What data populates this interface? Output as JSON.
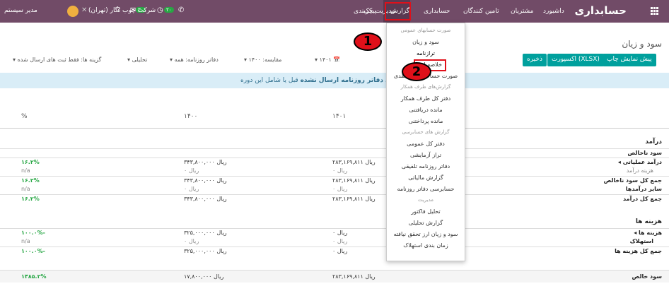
{
  "navbar": {
    "brand": "حسابداری",
    "menu": [
      {
        "label": "داشبورد"
      },
      {
        "label": "مشتریان"
      },
      {
        "label": "تامین کنندگان"
      },
      {
        "label": "حسابداری"
      },
      {
        "label": "مدیریت چک"
      },
      {
        "label": "گزارش"
      },
      {
        "label": "پیکربندی"
      }
    ],
    "company": "شرکت چوب نگار (تهران)",
    "user": "مدیر سیستم",
    "messages_badge": "۳۰",
    "activities_badge": "۲۰"
  },
  "control_panel": {
    "title": "سود و زیان",
    "buttons": {
      "print_preview": "پیش نمایش چاپ",
      "export_xlsx": "اکسپورت (XLSX)",
      "save": "ذخیره"
    },
    "filters": {
      "date": "۱۴۰۱",
      "comparison": "مقایسه: ۱۴۰۰",
      "journals": "دفاتر روزنامه: همه",
      "analytic": "تحلیلی",
      "options": "گزینه ها: فقط ثبت های ارسال شده"
    }
  },
  "alert": {
    "bold_text": "ای دفاتر روزنامه ارسال نشده",
    "rest_text": "قبل یا شامل این دوره"
  },
  "report": {
    "columns": {
      "percent": "%",
      "y1400": "۱۴۰۰",
      "y1401": "۱۴۰۱"
    },
    "income_title": "درآمد",
    "expense_title": "هزینه ها",
    "rows": [
      {
        "name": "سود ناخالص",
        "pct": "",
        "v1400": "",
        "v1401": ""
      },
      {
        "name": "درآمد عملیاتی",
        "pct": "۱۶.۲%",
        "v1400": "۳۴۳,۸۰۰,۰۰۰ ریال",
        "v1401": "۲۸۳,۱۶۹,۸۱۱ ریال"
      },
      {
        "name": "هزینه درآمد",
        "pct": "n/a",
        "v1400": "۰ ریال",
        "v1401": "۰ ریال"
      },
      {
        "name": "جمع کل سود ناخالص",
        "pct": "۱۶.۲%",
        "v1400": "۳۴۳,۸۰۰,۰۰۰ ریال",
        "v1401": "۲۸۳,۱۶۹,۸۱۱ ریال"
      },
      {
        "name": "سایر درآمدها",
        "pct": "n/a",
        "v1400": "۰ ریال",
        "v1401": "۰ ریال"
      },
      {
        "name": "جمع کل درآمد",
        "pct": "۱۶.۲%",
        "v1400": "۳۴۳,۸۰۰,۰۰۰ ریال",
        "v1401": "۲۸۳,۱۶۹,۸۱۱ ریال"
      },
      {
        "name": "هزینه ها",
        "pct": "۱۰۰.۰%-",
        "v1400": "۳۲۵,۰۰۰,۰۰۰ ریال",
        "v1401": "۰ ریال"
      },
      {
        "name": "استهلاک",
        "pct": "n/a",
        "v1400": "۰ ریال",
        "v1401": "۰ ریال"
      },
      {
        "name": "جمع کل هزینه ها",
        "pct": "۱۰۰.۰%-",
        "v1400": "۳۲۵,۰۰۰,۰۰۰ ریال",
        "v1401": "۰ ریال"
      },
      {
        "name": "سود خالص",
        "pct": "۱۴۸۵.۲%",
        "v1400": "۱۷,۸۰۰,۰۰۰ ریال",
        "v1401": "۲۸۳,۱۶۹,۸۱۱ ریال"
      }
    ]
  },
  "dropdown": {
    "items": [
      {
        "label": "صورت حسابهای عمومی",
        "type": "header"
      },
      {
        "label": "سود و زیان",
        "type": "item"
      },
      {
        "label": "ترازنامه",
        "type": "item"
      },
      {
        "label": "خلاصه اجرایی",
        "type": "item"
      },
      {
        "label": "صورت حساب گردش نقدی",
        "type": "item"
      },
      {
        "label": "گزارش‌های طرف همکار",
        "type": "header"
      },
      {
        "label": "دفتر کل طرف همکار",
        "type": "item"
      },
      {
        "label": "مانده دریافتنی",
        "type": "item"
      },
      {
        "label": "مانده پرداختنی",
        "type": "item"
      },
      {
        "label": "گزارش های حسابرسی",
        "type": "header"
      },
      {
        "label": "دفتر کل عمومی",
        "type": "item"
      },
      {
        "label": "تراز آزمایشی",
        "type": "item"
      },
      {
        "label": "دفاتر روزنامه تلفیقی",
        "type": "item"
      },
      {
        "label": "گزارش مالیاتی",
        "type": "item"
      },
      {
        "label": "حسابرسی دفاتر روزنامه",
        "type": "item"
      },
      {
        "label": "مدیریت",
        "type": "header"
      },
      {
        "label": "تحلیل فاکتور",
        "type": "item"
      },
      {
        "label": "گزارش تحلیلی",
        "type": "item"
      },
      {
        "label": "سود و زیان ارز تحقق نیافته",
        "type": "item"
      },
      {
        "label": "زمان بندی استهلاک",
        "type": "item"
      }
    ]
  },
  "callouts": {
    "first": "1",
    "second": "2"
  }
}
